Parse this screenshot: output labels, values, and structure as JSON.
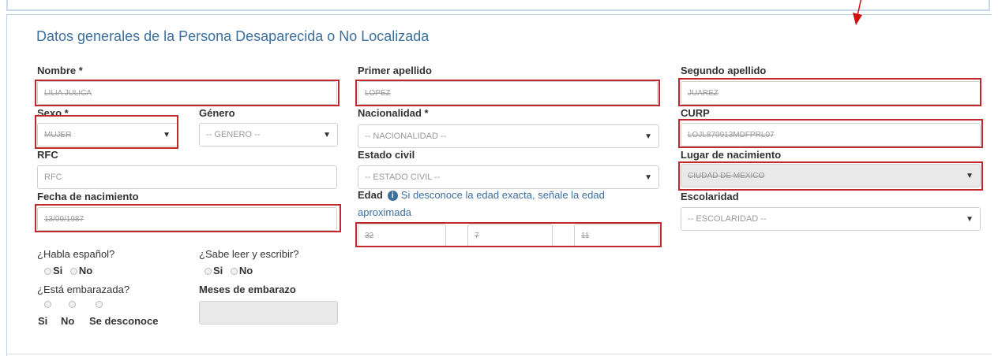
{
  "section_title": "Datos generales de la Persona Desaparecida o No Localizada",
  "labels": {
    "nombre": "Nombre *",
    "primer_apellido": "Primer apellido",
    "segundo_apellido": "Segundo apellido",
    "sexo": "Sexo *",
    "genero": "Género",
    "nacionalidad": "Nacionalidad *",
    "curp": "CURP",
    "rfc": "RFC",
    "estado_civil": "Estado civil",
    "lugar_nacimiento": "Lugar de nacimiento",
    "fecha_nacimiento": "Fecha de nacimiento",
    "edad": "Edad",
    "edad_help_1": "Si desconoce la edad exacta, señale la edad",
    "edad_help_2": "aproximada",
    "escolaridad": "Escolaridad",
    "habla_espanol": "¿Habla español?",
    "sabe_leer": "¿Sabe leer y escribir?",
    "embarazada": "¿Está embarazada?",
    "meses_embarazo": "Meses de embarazo"
  },
  "values": {
    "nombre": "LILIA JULICA",
    "primer_apellido": "LOPEZ",
    "segundo_apellido": "JUAREZ",
    "sexo": "MUJER",
    "curp": "LOJL870913MDFPRL07",
    "lugar_nacimiento": "CIUDAD DE MEXICO",
    "fecha_nacimiento": "13/09/1987",
    "edad_anios": "32",
    "edad_meses": "7",
    "edad_dias": "11"
  },
  "placeholders": {
    "genero": "-- GENERO --",
    "nacionalidad": "-- NACIONALIDAD --",
    "rfc": "RFC",
    "estado_civil": "-- ESTADO CIVIL --",
    "escolaridad": "-- ESCOLARIDAD --"
  },
  "options": {
    "si": "Si",
    "no": "No",
    "se_desconoce": "Se desconoce"
  },
  "caret": "▼"
}
